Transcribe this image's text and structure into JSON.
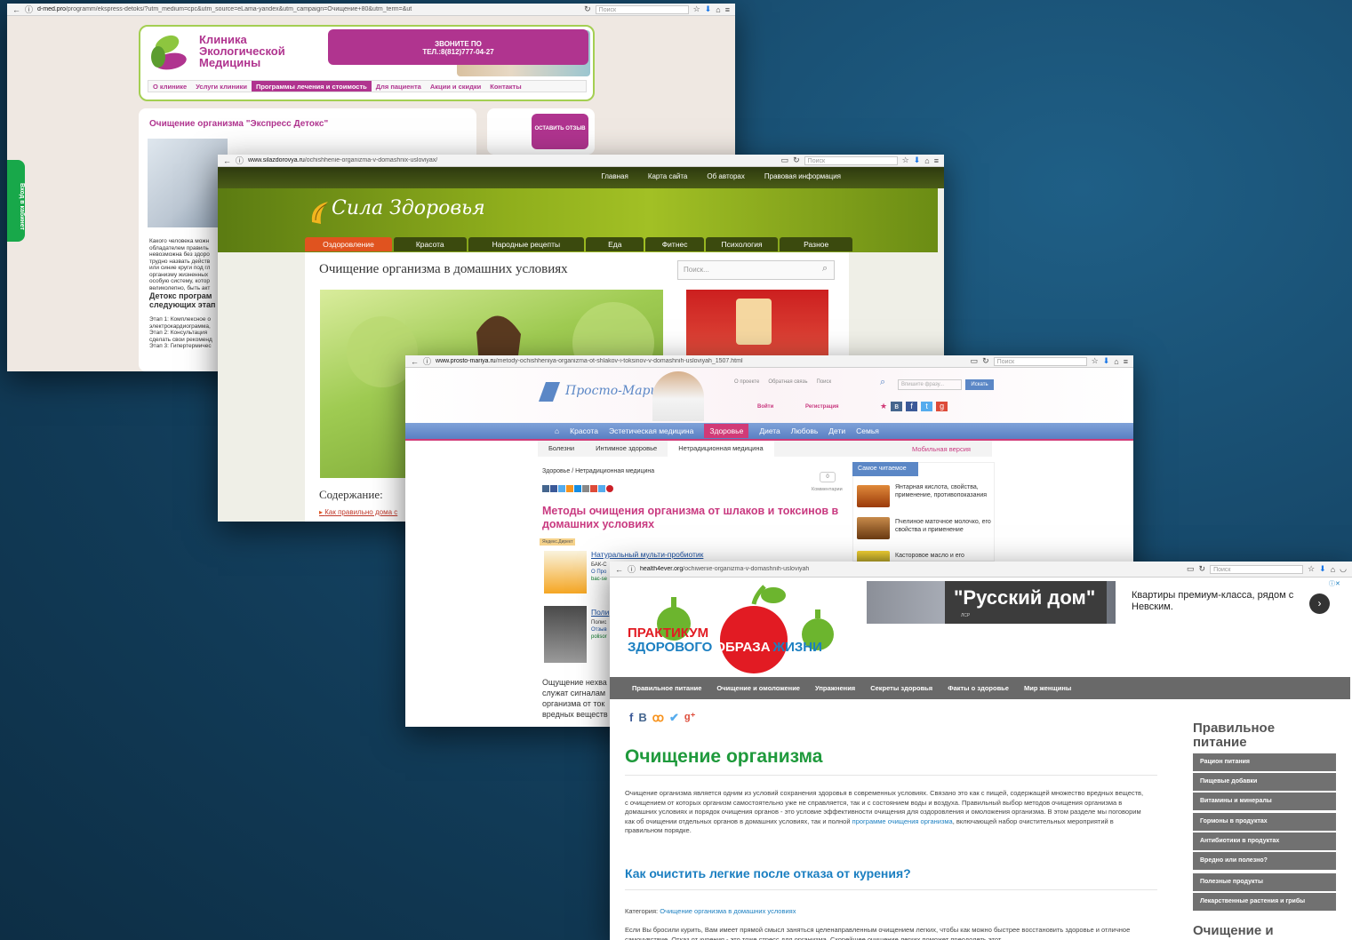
{
  "window1": {
    "url_domain": "d-med.pro",
    "url_path": "/programm/ekspress-detoks/?utm_medium=cpc&utm_source=eLama-yandex&utm_campaign=Очищение+80&utm_term=&ut",
    "search_placeholder": "Поиск",
    "clinic_name_line1": "Клиника",
    "clinic_name_line2": "Экологической",
    "clinic_name_line3": "Медицины",
    "call_label": "ЗВОНИТЕ ПО",
    "call_phone": "ТЕЛ.:8(812)777-04-27",
    "menu": [
      "О клинике",
      "Услуги клиники",
      "Программы лечения и стоимость",
      "Для пациента",
      "Акции и скидки",
      "Контакты"
    ],
    "page_title": "Очищение организма \"Экспресс Детокс\"",
    "review_button": "ОСТАВИТЬ ОТЗЫВ",
    "cabinet_tab": "Вход в кабинет",
    "text_lines": [
      "Какого человека можн",
      "обладателем правиль",
      "невозможна без здоро",
      "трудно назвать действ",
      "или синие круги под гл",
      "организму жизненных",
      "особую систему, котор",
      "великолепно, быть акт"
    ],
    "detox_heading": "Детокс програм",
    "detox_heading2": "следующих этап",
    "stages": [
      "Этап 1: Комплексное о",
      "электрокардиограмма,",
      "Этап 2: Консультация",
      "сделать свои рекоменд",
      "Этап 3: Гипертермичес"
    ]
  },
  "window2": {
    "url_domain": "www.silazdorovya.ru",
    "url_path": "/ochishhenie-organizma-v-domashnix-usloviyax/",
    "search_placeholder": "Поиск",
    "top_links": [
      "Главная",
      "Карта сайта",
      "Об авторах",
      "Правовая информация"
    ],
    "logo": "Сила Здоровья",
    "nav": [
      "Оздоровление",
      "Красота",
      "Народные рецепты",
      "Еда",
      "Фитнес",
      "Психология",
      "Разное"
    ],
    "title": "Очищение организма в домашних условиях",
    "site_search_placeholder": "Поиск...",
    "contents_heading": "Содержание:",
    "contents_item": "Как правильно дома с"
  },
  "window3": {
    "url_domain": "www.prosto-mariya.ru",
    "url_path": "/metody-ochishheniya-organizma-ot-shlakov-i-toksinov-v-domashnih-usloviyah_1507.html",
    "search_placeholder": "Поиск",
    "logo": "Просто-Мария.ру",
    "top_links": [
      "О проекте",
      "Обратная связь",
      "Поиск"
    ],
    "site_search_placeholder": "Впишите фразу...",
    "search_button": "Искать",
    "login": "Войти",
    "register": "Регистрация",
    "nav": [
      "Красота",
      "Эстетическая медицина",
      "Здоровье",
      "Диета",
      "Любовь",
      "Дети",
      "Семья"
    ],
    "subnav": [
      "Болезни",
      "Интимное здоровье",
      "Нетрадиционная медицина"
    ],
    "mobile": "Мобильная версия",
    "breadcrumb": "Здоровье / Нетрадиционная медицина",
    "comments_count": "0",
    "comments_label": "Комментарии",
    "title": "Методы очищения организма от шлаков и токсинов в домашних условиях",
    "yandex_direct": "Яндекс.Директ",
    "ad_title": "Натуральный мульти-пробиотик",
    "ad_line1": "БАК-С",
    "ad_line2": "О Про",
    "ad_line3": "bac-se",
    "ad2_title": "Поли",
    "ad2_line1": "Полис",
    "ad2_line2": "Отзыв",
    "ad2_line3": "polisor",
    "body_lines": [
      "Ощущение нехва",
      "служат сигналам",
      "организма от ток",
      "вредных веществ"
    ],
    "most_read_tab": "Самое читаемое",
    "most_read": [
      "Янтарная кислота, свойства, применение, противопоказания",
      "Пчелиное маточное молочко, его свойства и применение",
      "Касторовое масло и его"
    ]
  },
  "window4": {
    "url_domain": "health4ever.org",
    "url_path": "/ochiwenie-organizma-v-domashnih-usloviyah",
    "search_placeholder": "Поиск",
    "logo_line1": "ПРАКТИКУМ",
    "logo_line2a": "ЗДОРОВОГО",
    "logo_line2b": "ОБРАЗА",
    "logo_line2c": "ЖИЗНИ",
    "banner_title": "\"Русский дом\"",
    "banner_text": "Квартиры премиум-класса, рядом с Невским.",
    "banner_brand": "ЛСР",
    "nav": [
      "Правильное питание",
      "Очищение и омоложение",
      "Упражнения",
      "Секреты здоровья",
      "Факты о здоровье",
      "Мир женщины"
    ],
    "title": "Очищение организма",
    "intro_before_link": "Очищение организма является одним из условий сохранения здоровья в современных условиях. Связано это как с пищей, содержащей множество вредных веществ, с очищением от которых организм самостоятельно уже не справляется, так и с состоянием воды и воздуха. Правильный выбор методов очищения организма в домашних условиях и порядок очищения органов - это условие эффективности очищения для оздоровления и омоложения организма. В этом разделе мы поговорим как об очищении отдельных органов в домашних условиях, так и полной",
    "intro_link": "программе очищения организма",
    "intro_after_link": ", включающей набор очистительных мероприятий в правильном порядке.",
    "article_title": "Как очистить легкие после отказа от курения?",
    "category_label": "Категория:",
    "category_link": "Очищение организма в домашних условиях",
    "article_text": "Если Вы бросили курить, Вам имеет прямой смысл заняться целенаправленным очищением легких, чтобы как можно быстрее восстановить здоровье и отличное самочувствие. Отказ от курения - это тоже стресс для организма. Скорейшее очищение легких поможет преодолеть этот",
    "sidebar_heading": "Правильное питание",
    "sidebar_items": [
      "Рацион питания",
      "Пищевые добавки",
      "Витамины и минералы",
      "Гормоны в продуктах",
      "Антибиотики в продуктах",
      "Вредно или полезно?",
      "Полезные продукты",
      "Лекарственные растения и грибы"
    ],
    "sidebar_heading2": "Очищение и"
  },
  "colors": {
    "clinic_accent": "#b0348f",
    "sila_green": "#6b8c14",
    "sila_orange": "#e0531f",
    "mariya_blue": "#5a80c3",
    "mariya_pink": "#d13a77",
    "health_green": "#1f9a3c",
    "health_link": "#1b7fc1",
    "desktop_bg": "#174a6c"
  }
}
